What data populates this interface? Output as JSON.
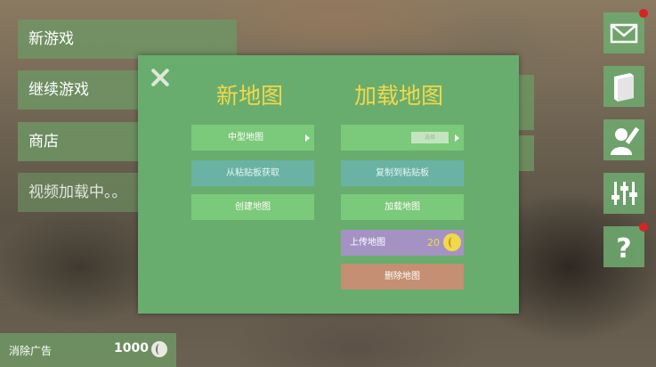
{
  "main_menu": {
    "new_game": "新游戏",
    "continue_game": "继续游戏",
    "shop": "商店",
    "video_loading": "视频加载中。。"
  },
  "remove_ads": {
    "label": "消除广告",
    "cost": "1000"
  },
  "side_icons": [
    "mail-icon",
    "book-icon",
    "profile-icon",
    "settings-sliders-icon",
    "help-icon"
  ],
  "dialog": {
    "new_map_title": "新地图",
    "load_map_title": "加载地图",
    "map_size_selected": "中型地图",
    "paste_from_clipboard": "从粘贴板获取",
    "create_map": "创建地图",
    "map_select_chip": "选择",
    "copy_to_clipboard": "复制到粘贴板",
    "load_map": "加载地图",
    "upload_map": "上传地图",
    "upload_cost": "20",
    "delete_map": "删除地图"
  },
  "colors": {
    "dialog_bg": "#69ad6e",
    "title": "#f2d84a",
    "button_green": "#7bc97a",
    "button_teal": "#6ab3a4",
    "button_purple": "#a493c2",
    "button_orange": "#c48f72",
    "notification_dot": "#d62424"
  }
}
